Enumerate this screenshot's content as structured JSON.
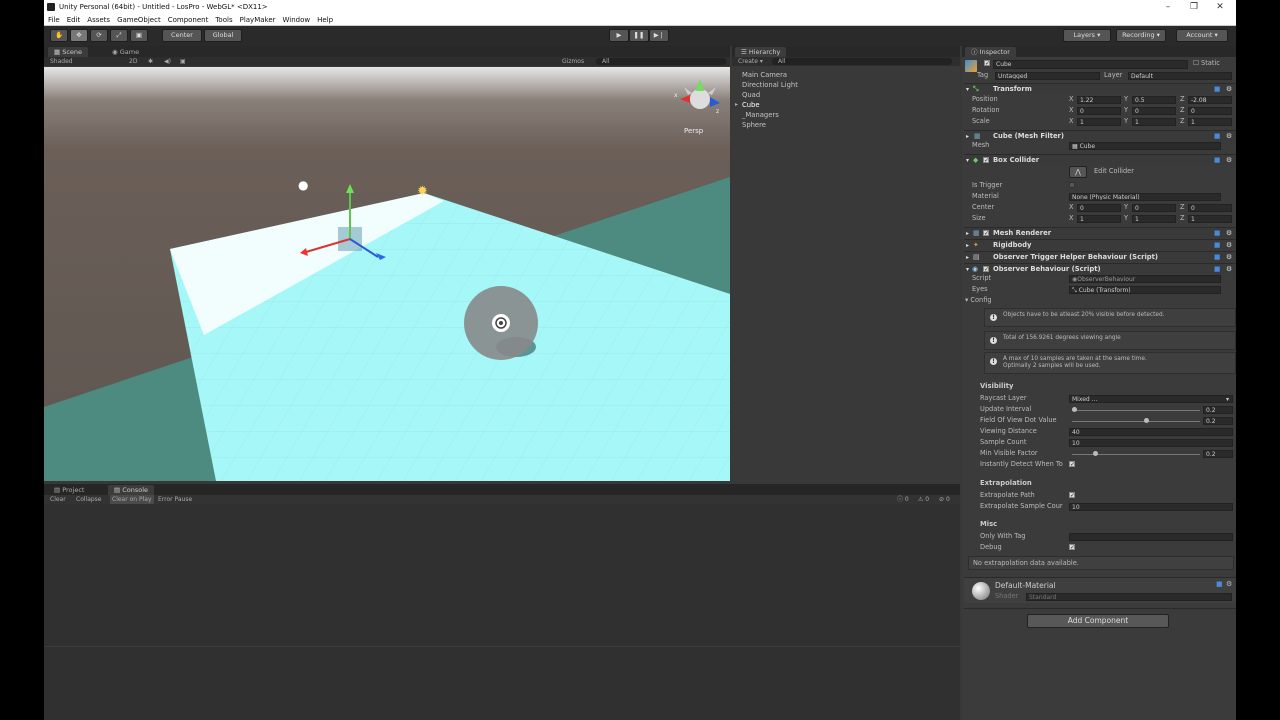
{
  "window": {
    "title": "Unity Personal (64bit) - Untitled - LosPro - WebGL* <DX11>"
  },
  "menu": [
    "File",
    "Edit",
    "Assets",
    "GameObject",
    "Component",
    "Tools",
    "PlayMaker",
    "Window",
    "Help"
  ],
  "toolbar": {
    "center": "Center",
    "global": "Global",
    "layers": "Layers",
    "recording": "Recording",
    "account": "Account"
  },
  "scene": {
    "tab_scene": "Scene",
    "tab_game": "Game",
    "shaded": "Shaded",
    "mode2d": "2D",
    "gizmos": "Gizmos",
    "search": "All",
    "persp": "Persp"
  },
  "hierarchy": {
    "tab": "Hierarchy",
    "create": "Create",
    "search": "All",
    "items": [
      "Main Camera",
      "Directional Light",
      "Quad",
      "Cube",
      "_Managers",
      "Sphere"
    ]
  },
  "bottom": {
    "tab_project": "Project",
    "tab_console": "Console",
    "buttons": [
      "Clear",
      "Collapse",
      "Clear on Play",
      "Error Pause"
    ],
    "counts": [
      "0",
      "0",
      "0"
    ]
  },
  "inspector": {
    "tab": "Inspector",
    "name": "Cube",
    "static": "Static",
    "tag_label": "Tag",
    "tag": "Untagged",
    "layer_label": "Layer",
    "layer": "Default",
    "transform": {
      "title": "Transform",
      "position": "Position",
      "rotation": "Rotation",
      "scale": "Scale",
      "pos": [
        "X",
        "1.22",
        "Y",
        "0.5",
        "Z",
        "-2.08"
      ],
      "rot": [
        "X",
        "0",
        "Y",
        "0",
        "Z",
        "0"
      ],
      "scl": [
        "X",
        "1",
        "Y",
        "1",
        "Z",
        "1"
      ]
    },
    "mesh_filter": {
      "title": "Cube (Mesh Filter)",
      "mesh_label": "Mesh",
      "mesh": "Cube"
    },
    "box_collider": {
      "title": "Box Collider",
      "edit": "Edit Collider",
      "is_trigger": "Is Trigger",
      "material_label": "Material",
      "material": "None (Physic Material)",
      "center": "Center",
      "center_v": [
        "X",
        "0",
        "Y",
        "0",
        "Z",
        "0"
      ],
      "size": "Size",
      "size_v": [
        "X",
        "1",
        "Y",
        "1",
        "Z",
        "1"
      ]
    },
    "mesh_renderer": "Mesh Renderer",
    "rigidbody": "Rigidbody",
    "trigger_helper": "Observer Trigger Helper Behaviour (Script)",
    "observer": {
      "title": "Observer Behaviour (Script)",
      "script_label": "Script",
      "script": "ObserverBehaviour",
      "eyes_label": "Eyes",
      "eyes": "Cube (Transform)",
      "config": "Config",
      "info1": "Objects have to be atleast 20% visible before detected.",
      "info2": "Total of 156.9261 degrees viewing angle",
      "info3a": "A max of 10 samples are taken at the same time.",
      "info3b": "Optimally 2 samples will be used.",
      "visibility": "Visibility",
      "raycast_layer": "Raycast Layer",
      "raycast_value": "Mixed ...",
      "update_interval": "Update Interval",
      "update_interval_v": "0.2",
      "fov_dot": "Field Of View Dot Value",
      "fov_dot_v": "0.2",
      "view_dist": "Viewing Distance",
      "view_dist_v": "40",
      "sample_count": "Sample Count",
      "sample_count_v": "10",
      "min_vis": "Min Visible Factor",
      "min_vis_v": "0.2",
      "instant": "Instantly Detect When To",
      "extrapolation": "Extrapolation",
      "extra_path": "Extrapolate Path",
      "extra_count": "Extrapolate Sample Cour",
      "extra_count_v": "10",
      "misc": "Misc",
      "only_tag": "Only With Tag",
      "debug": "Debug",
      "no_data": "No extrapolation data available."
    },
    "material": {
      "name": "Default-Material",
      "shader_label": "Shader",
      "shader": "Standard"
    },
    "add_component": "Add Component"
  },
  "colors": {
    "bg": "#383838",
    "toolbar": "#2a2a2a",
    "scene_ground": "#4d8a80",
    "plane": "#a6f7f7",
    "sky": "#6b5f58"
  }
}
